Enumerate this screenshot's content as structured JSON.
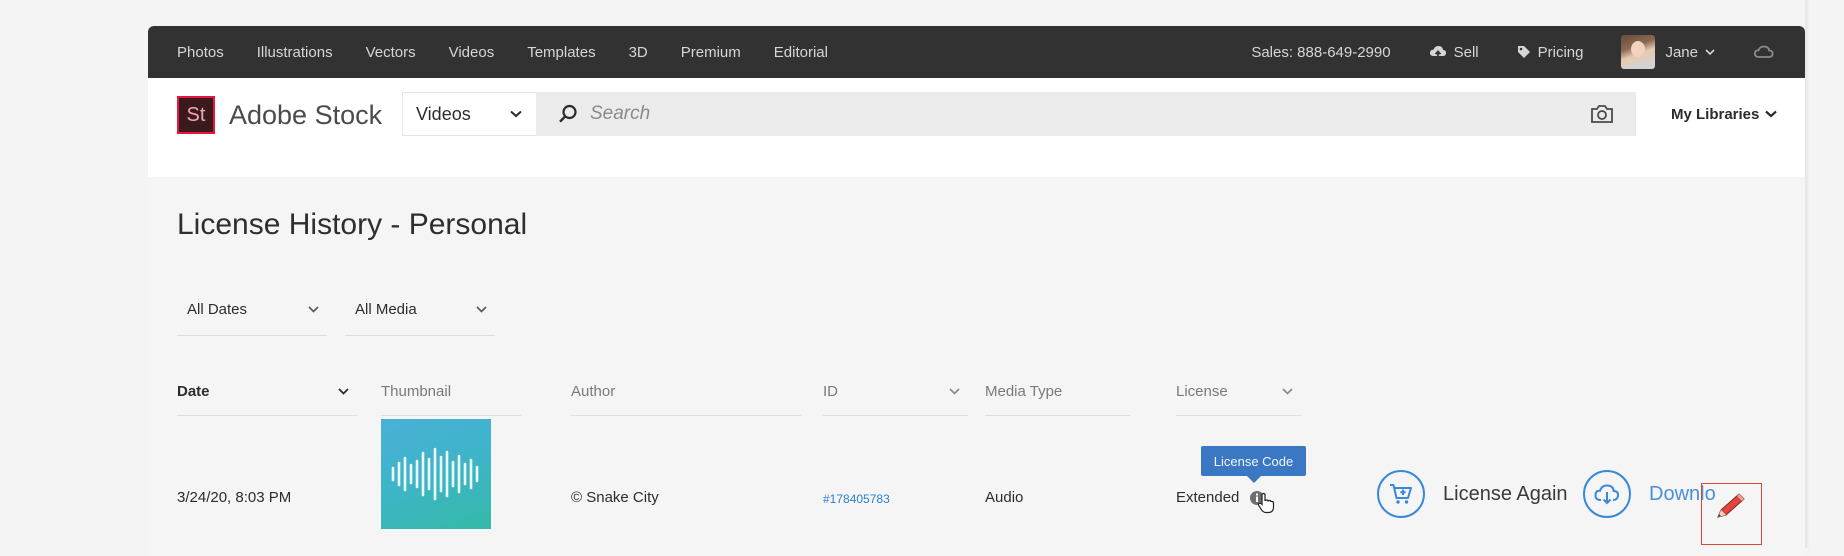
{
  "topbar": {
    "nav": [
      "Photos",
      "Illustrations",
      "Vectors",
      "Videos",
      "Templates",
      "3D",
      "Premium",
      "Editorial"
    ],
    "sales": "Sales: 888-649-2990",
    "sell": "Sell",
    "pricing": "Pricing",
    "user": "Jane"
  },
  "header": {
    "logo_mark": "St",
    "brand": "Adobe Stock",
    "scope_value": "Videos",
    "search_placeholder": "Search",
    "my_libraries": "My Libraries"
  },
  "page": {
    "title": "License History - Personal",
    "filters": {
      "dates": "All Dates",
      "media": "All Media"
    }
  },
  "table": {
    "columns": {
      "date": "Date",
      "thumbnail": "Thumbnail",
      "author": "Author",
      "id": "ID",
      "media_type": "Media Type",
      "license": "License"
    },
    "rows": [
      {
        "date": "3/24/20, 8:03 PM",
        "author": "© Snake City",
        "id": "#178405783",
        "media_type": "Audio",
        "license": "Extended"
      }
    ]
  },
  "tooltip": "License Code",
  "actions": {
    "license_again": "License Again",
    "download": "Downlo"
  },
  "colors": {
    "topbar": "#323232",
    "accent": "#3b87d8",
    "brand": "#e8163c",
    "highlight": "#d9463a"
  },
  "icons": [
    "cloud-upload-icon",
    "tag-icon",
    "chevron-down-icon",
    "creative-cloud-icon",
    "search-icon",
    "camera-icon",
    "info-icon",
    "cart-icon",
    "download-icon",
    "pencil-icon"
  ]
}
